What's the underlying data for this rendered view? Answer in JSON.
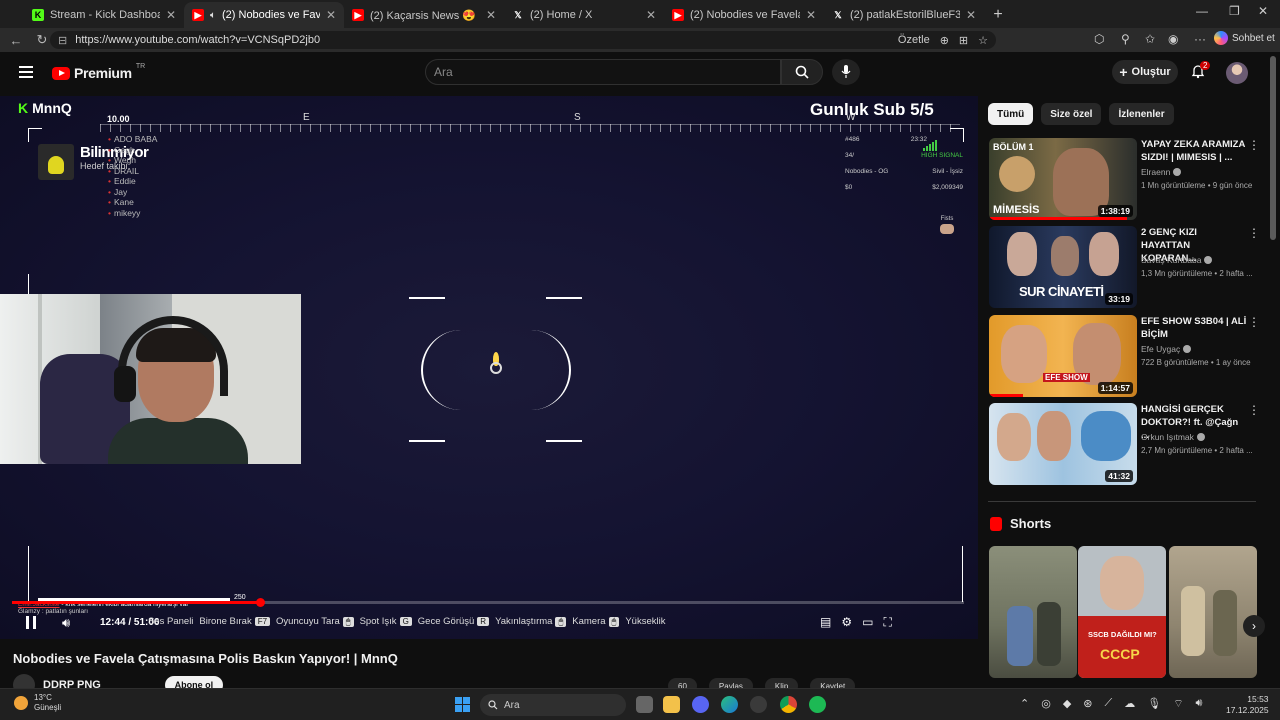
{
  "browser": {
    "tabs": [
      {
        "title": "Stream - Kick Dashboard",
        "icon": "kick-icon"
      },
      {
        "title": "(2) Nobodies ve Favela Çatışma",
        "icon": "youtube-icon",
        "active": true
      },
      {
        "title": "(2) Kaçarsis News 😍 | EkremYaldız",
        "icon": "youtube-icon"
      },
      {
        "title": "(2) Home / X",
        "icon": "x-icon"
      },
      {
        "title": "(2) Nobodies ve Favela Çatışmasına",
        "icon": "youtube-icon"
      },
      {
        "title": "(2) patlakEstorilBlueF30 on X: \"son",
        "icon": "x-icon"
      }
    ],
    "url": "https://www.youtube.com/watch?v=VCNSqPD2jb0",
    "summarize_label": "Özetle",
    "copilot_label": "Sohbet et"
  },
  "youtube": {
    "logo_text": "Premium",
    "logo_region": "TR",
    "search_placeholder": "Ara",
    "create_label": "Oluştur",
    "notif_count": "2"
  },
  "video": {
    "overlay": {
      "streamer": "MnnQ",
      "sub_goal": "Gunluk Sub 5/5",
      "altitude": "10.00",
      "compass": [
        "E",
        "S",
        "W"
      ],
      "player_name": "Bilinmiyor",
      "player_sub": "Hedef takibi",
      "name_list": [
        "ADO BABA",
        "Gegh",
        "Wegh",
        "DRAIL",
        "Eddie",
        "Jay",
        "Kane",
        "mikeyy"
      ],
      "hud_time": "23:32",
      "hud_signal": "HIGH SIGNAL",
      "hud_id": "#486",
      "hud_hp": "34/",
      "hud_job": "Nobodies - OG",
      "hud_status": "Sivil - İşsiz",
      "hud_cash": "$0",
      "hud_bank": "$2,009349",
      "hud_fists": "Fists",
      "hp_value": "250",
      "notice_user": "Emir.Jacksiste",
      "notice_text": "- knk senelerin ekibi adamlarda hiyerarşi var",
      "chat_line2": "Glamzy : patlatın şunları"
    },
    "time_current": "12:44",
    "time_total": "51:06",
    "progress_fraction": 0.26,
    "key_hints": [
      {
        "label": "Ses Paneli",
        "key": ""
      },
      {
        "label": "Birone Bırak",
        "key": "F7"
      },
      {
        "label": "Oyuncuyu Tara",
        "key": "🖱"
      },
      {
        "label": "Spot Işık",
        "key": "G"
      },
      {
        "label": "Gece Görüşü",
        "key": "R"
      },
      {
        "label": "Yakınlaştırma",
        "key": "🖱"
      },
      {
        "label": "Kamera",
        "key": "🖱"
      },
      {
        "label": "Yükseklik",
        "key": ""
      }
    ],
    "title": "Nobodies ve Favela Çatışmasına Polis Baskın Yapıyor! | MnnQ",
    "channel": "DDRP PNG",
    "subscribe": "Abone ol",
    "actions": [
      "60",
      "Paylaş",
      "Klip",
      "Kaydet"
    ]
  },
  "sidebar": {
    "chips": [
      "Tümü",
      "Size özel",
      "İzlenenler"
    ],
    "recommendations": [
      {
        "title": "YAPAY ZEKA ARAMIZA SIZDI! | MIMESIS | ...",
        "channel": "Elraenn",
        "meta": "1 Mn görüntüleme • 9 gün önce",
        "duration": "1:38:19",
        "watched": 0.93
      },
      {
        "title": "2 GENÇ KIZI HAYATTAN KOPARAN...",
        "channel": "Savaş Kurtbaba",
        "meta": "1,3 Mn görüntüleme • 2 hafta ...",
        "duration": "33:19",
        "watched": 0
      },
      {
        "title": "EFE SHOW S3B04 | ALİ BİÇİM",
        "channel": "Efe Uygaç",
        "meta": "722 B görüntüleme • 1 ay önce",
        "duration": "1:14:57",
        "watched": 0.23
      },
      {
        "title": "HANGİSİ GERÇEK DOKTOR?! ft. @Çağn ...",
        "channel": "Orkun Işıtmak",
        "meta": "2,7 Mn görüntüleme • 2 hafta ...",
        "duration": "41:32",
        "watched": 0
      }
    ],
    "thumb_text": [
      "BÖLÜM 1",
      "MİMESİS",
      "SUR CİNAYETİ",
      "EFE SHOW"
    ],
    "shorts_title": "Shorts",
    "short_texts": [
      "SSCB DAĞILDI MI?",
      "СССР"
    ]
  },
  "taskbar": {
    "temp": "13°C",
    "weather": "Güneşli",
    "search": "Ara",
    "time": "15:53",
    "date": "17.12.2025"
  }
}
